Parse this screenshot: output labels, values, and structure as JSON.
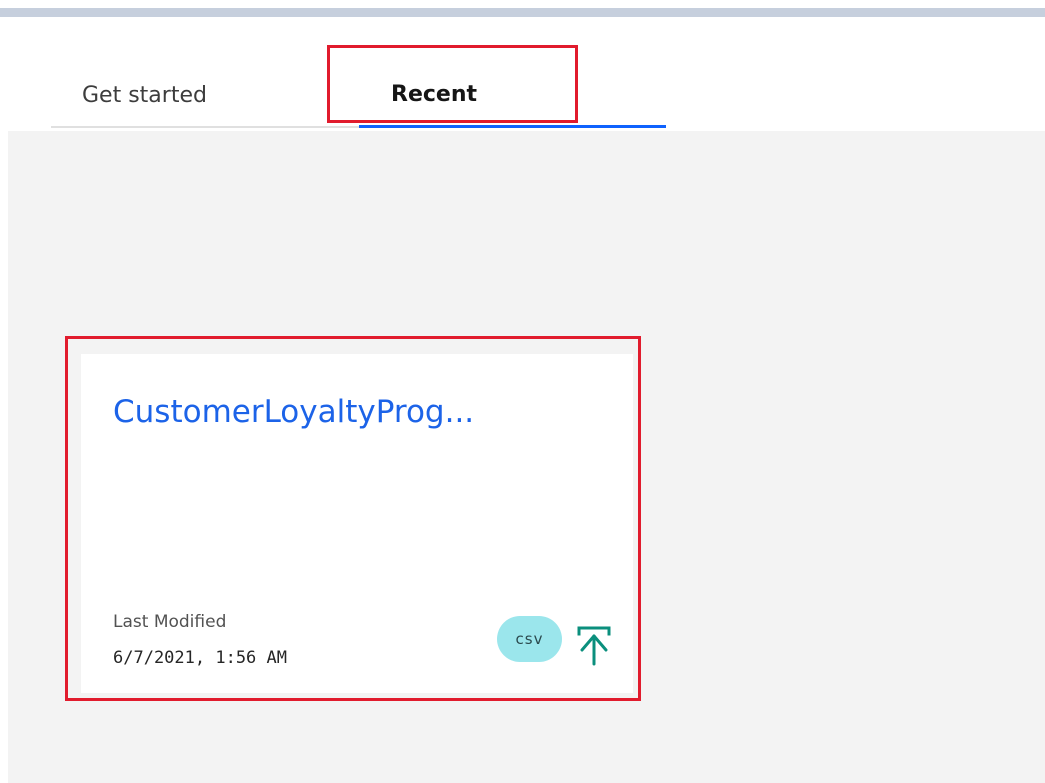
{
  "tabs": {
    "get_started": "Get started",
    "recent": "Recent"
  },
  "card": {
    "title": "CustomerLoyaltyProg...",
    "meta_label": "Last Modified",
    "meta_value": "6/7/2021, 1:56 AM",
    "badge": "csv",
    "upload_icon": "upload-icon"
  },
  "colors": {
    "accent": "#0f62fe",
    "title_blue": "#1c63e8",
    "highlight_red": "#e11b2d",
    "badge_bg": "#9be6ec",
    "icon_teal": "#0b8f7d",
    "content_bg": "#f3f3f3"
  }
}
